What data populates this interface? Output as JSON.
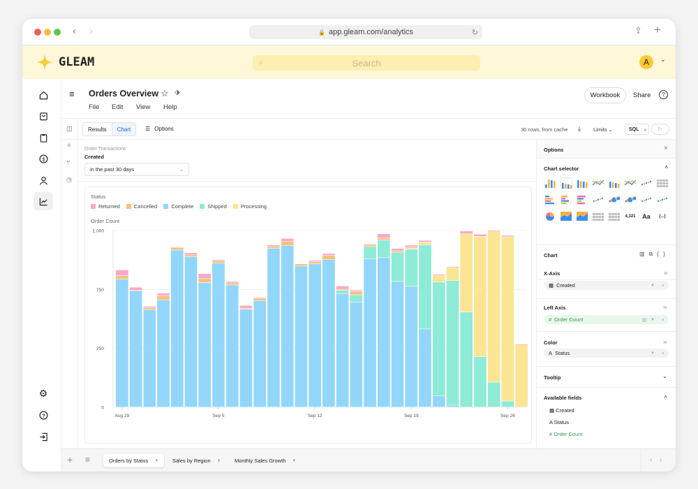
{
  "browser": {
    "url": "app.gleam.com/analytics"
  },
  "app": {
    "name": "GLEAM",
    "search_placeholder": "Search",
    "avatar_letter": "A"
  },
  "sidebar": {
    "items": [
      "home",
      "shopping-bag",
      "clipboard",
      "dollar",
      "user",
      "analytics"
    ],
    "bottom": [
      "settings",
      "help",
      "logout"
    ],
    "active": "analytics"
  },
  "header": {
    "title": "Orders Overview",
    "menus": [
      "File",
      "Edit",
      "View",
      "Help"
    ],
    "workbook": "Workbook",
    "share": "Share"
  },
  "toolbar": {
    "tabs": [
      "Results",
      "Chart"
    ],
    "active_tab": "Chart",
    "options": "Options",
    "status": "30 rows, from cache",
    "limits": "Limits",
    "sql": "SQL"
  },
  "filter": {
    "source": "Order Transactions",
    "field": "Created",
    "value": "in the past 30 days"
  },
  "options": {
    "title": "Options",
    "chart_selector": "Chart selector",
    "chart_types": [
      "bar",
      "stacked-bar",
      "stacked-bar-100",
      "line",
      "bar-line",
      "big-number-trend",
      "map-points",
      "table",
      "horizontal-bar",
      "stacked-horizontal-bar",
      "stacked-horizontal-bar-100",
      "scatter",
      "bubble",
      "bubble-colored",
      "map-region",
      "heatmap",
      "pie",
      "area",
      "stacked-area",
      "box-plot",
      "list",
      "4,321",
      "Aa",
      "{...}"
    ],
    "selected_chart": "stacked-bar",
    "chart": "Chart",
    "x_axis": {
      "label": "X-Axis",
      "field": "Created"
    },
    "left_axis": {
      "label": "Left Axis",
      "field": "Order Count"
    },
    "color": {
      "label": "Color",
      "field": "Status"
    },
    "tooltip": "Tooltip",
    "available_fields": {
      "label": "Available fields",
      "fields": [
        "Created",
        "Status",
        "Order Count"
      ]
    }
  },
  "bottom_tabs": [
    "Orders by Status",
    "Sales by Region",
    "Monthly Sales Growth"
  ],
  "active_bottom_tab": "Orders by Status",
  "chart_data": {
    "type": "bar",
    "stacked": true,
    "legend_title": "Status",
    "ylabel": "Order Count",
    "ylim": [
      0,
      1000
    ],
    "y_tick_labels": [
      "0",
      "250",
      "750",
      "1,000"
    ],
    "x_tick_labels": [
      "Aug 29",
      "Sep 5",
      "Sep 12",
      "Sep 19",
      "Sep 26"
    ],
    "categories": [
      "Aug 29",
      "Aug 30",
      "Aug 31",
      "Sep 1",
      "Sep 2",
      "Sep 3",
      "Sep 4",
      "Sep 5",
      "Sep 6",
      "Sep 7",
      "Sep 8",
      "Sep 9",
      "Sep 10",
      "Sep 11",
      "Sep 12",
      "Sep 13",
      "Sep 14",
      "Sep 15",
      "Sep 16",
      "Sep 17",
      "Sep 18",
      "Sep 19",
      "Sep 20",
      "Sep 21",
      "Sep 22",
      "Sep 23",
      "Sep 24",
      "Sep 25",
      "Sep 26",
      "Sep 27"
    ],
    "legend": [
      "Returned",
      "Cancelled",
      "Complete",
      "Shipped",
      "Processing"
    ],
    "series": [
      {
        "name": "Complete",
        "color": "#93d6fb",
        "values": [
          723,
          657,
          551,
          607,
          888,
          851,
          704,
          815,
          691,
          553,
          602,
          898,
          914,
          798,
          811,
          835,
          640,
          594,
          839,
          846,
          711,
          683,
          442,
          63,
          11,
          0,
          0,
          0,
          0,
          0
        ]
      },
      {
        "name": "Shipped",
        "color": "#8eebd6",
        "values": [
          0,
          0,
          0,
          0,
          0,
          0,
          0,
          0,
          0,
          0,
          0,
          0,
          0,
          0,
          0,
          0,
          20,
          41,
          69,
          99,
          165,
          209,
          476,
          644,
          705,
          538,
          285,
          141,
          34,
          0
        ]
      },
      {
        "name": "Processing",
        "color": "#fbe593",
        "values": [
          0,
          0,
          0,
          0,
          0,
          0,
          0,
          0,
          0,
          0,
          0,
          0,
          0,
          0,
          0,
          0,
          0,
          0,
          0,
          0,
          0,
          6,
          16,
          37,
          72,
          442,
          681,
          856,
          930,
          354
        ]
      },
      {
        "name": "Cancelled",
        "color": "#f6c27a",
        "values": [
          20,
          4,
          11,
          24,
          13,
          10,
          23,
          13,
          12,
          6,
          13,
          10,
          23,
          12,
          11,
          23,
          6,
          18,
          10,
          13,
          8,
          8,
          0,
          0,
          0,
          0,
          0,
          0,
          0,
          0
        ]
      },
      {
        "name": "Returned",
        "color": "#f7a8cc",
        "values": [
          33,
          17,
          8,
          14,
          5,
          12,
          28,
          6,
          8,
          16,
          4,
          9,
          17,
          0,
          8,
          11,
          19,
          8,
          5,
          22,
          13,
          10,
          9,
          7,
          6,
          16,
          12,
          3,
          8,
          2
        ]
      }
    ],
    "grid": true
  }
}
